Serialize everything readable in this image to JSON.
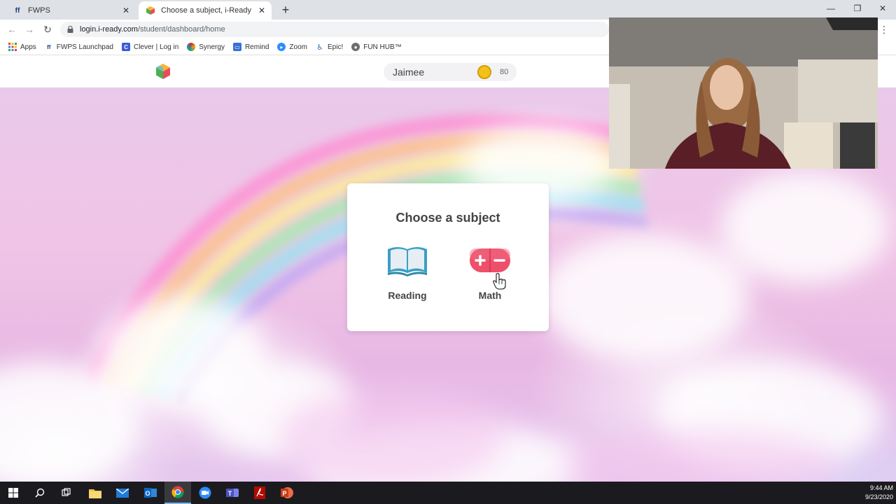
{
  "browser": {
    "tabs": [
      {
        "title": "FWPS",
        "active": false,
        "favicon": "fwps-icon"
      },
      {
        "title": "Choose a subject, i-Ready",
        "active": true,
        "favicon": "iready-cube-icon"
      }
    ],
    "url_host": "login.i-ready.com",
    "url_path": "/student/dashboard/home",
    "bookmarks": [
      {
        "label": "Apps",
        "icon": "apps-grid-icon",
        "color": "#4285f4"
      },
      {
        "label": "FWPS Launchpad",
        "icon": "fwps-icon",
        "color": "#1a3f8b"
      },
      {
        "label": "Clever | Log in",
        "icon": "clever-icon",
        "color": "#3b5bd9"
      },
      {
        "label": "Synergy",
        "icon": "synergy-icon",
        "color": "#c0392b"
      },
      {
        "label": "Remind",
        "icon": "remind-icon",
        "color": "#3a6fd8"
      },
      {
        "label": "Zoom",
        "icon": "zoom-icon",
        "color": "#2d8cff"
      },
      {
        "label": "Epic!",
        "icon": "epic-icon",
        "color": "#2a6fc9"
      },
      {
        "label": "FUN HUB™",
        "icon": "fun-hub-icon",
        "color": "#6d6d6d"
      }
    ]
  },
  "header": {
    "student_name": "Jaimee",
    "coins": "80"
  },
  "card": {
    "title": "Choose a subject",
    "subjects": [
      {
        "label": "Reading",
        "icon": "open-book-icon"
      },
      {
        "label": "Math",
        "icon": "plus-minus-icon"
      }
    ]
  },
  "taskbar": {
    "time": "9:44 AM",
    "date": "9/23/2020"
  },
  "colors": {
    "book_blue": "#3a9fc4",
    "math_pink": "#ee4f6b",
    "coin_gold": "#f2c21a"
  }
}
